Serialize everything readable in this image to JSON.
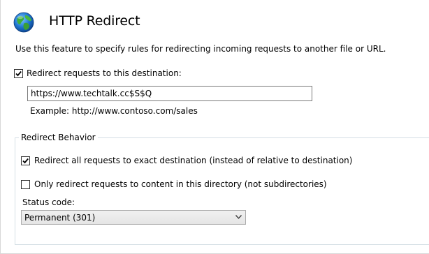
{
  "header": {
    "title": "HTTP Redirect",
    "icon": "globe-icon"
  },
  "description": "Use this feature to specify rules for redirecting incoming requests to another file or URL.",
  "redirect": {
    "checkbox_label": "Redirect requests to this destination:",
    "checked": true,
    "destination_value": "https://www.techtalk.cc$S$Q",
    "example": "Example: http://www.contoso.com/sales"
  },
  "behavior": {
    "group_title": "Redirect Behavior",
    "exact_label": "Redirect all requests to exact destination (instead of relative to destination)",
    "exact_checked": true,
    "only_dir_label": "Only redirect requests to content in this directory (not subdirectories)",
    "only_dir_checked": false,
    "status_label": "Status code:",
    "status_value": "Permanent (301)"
  }
}
